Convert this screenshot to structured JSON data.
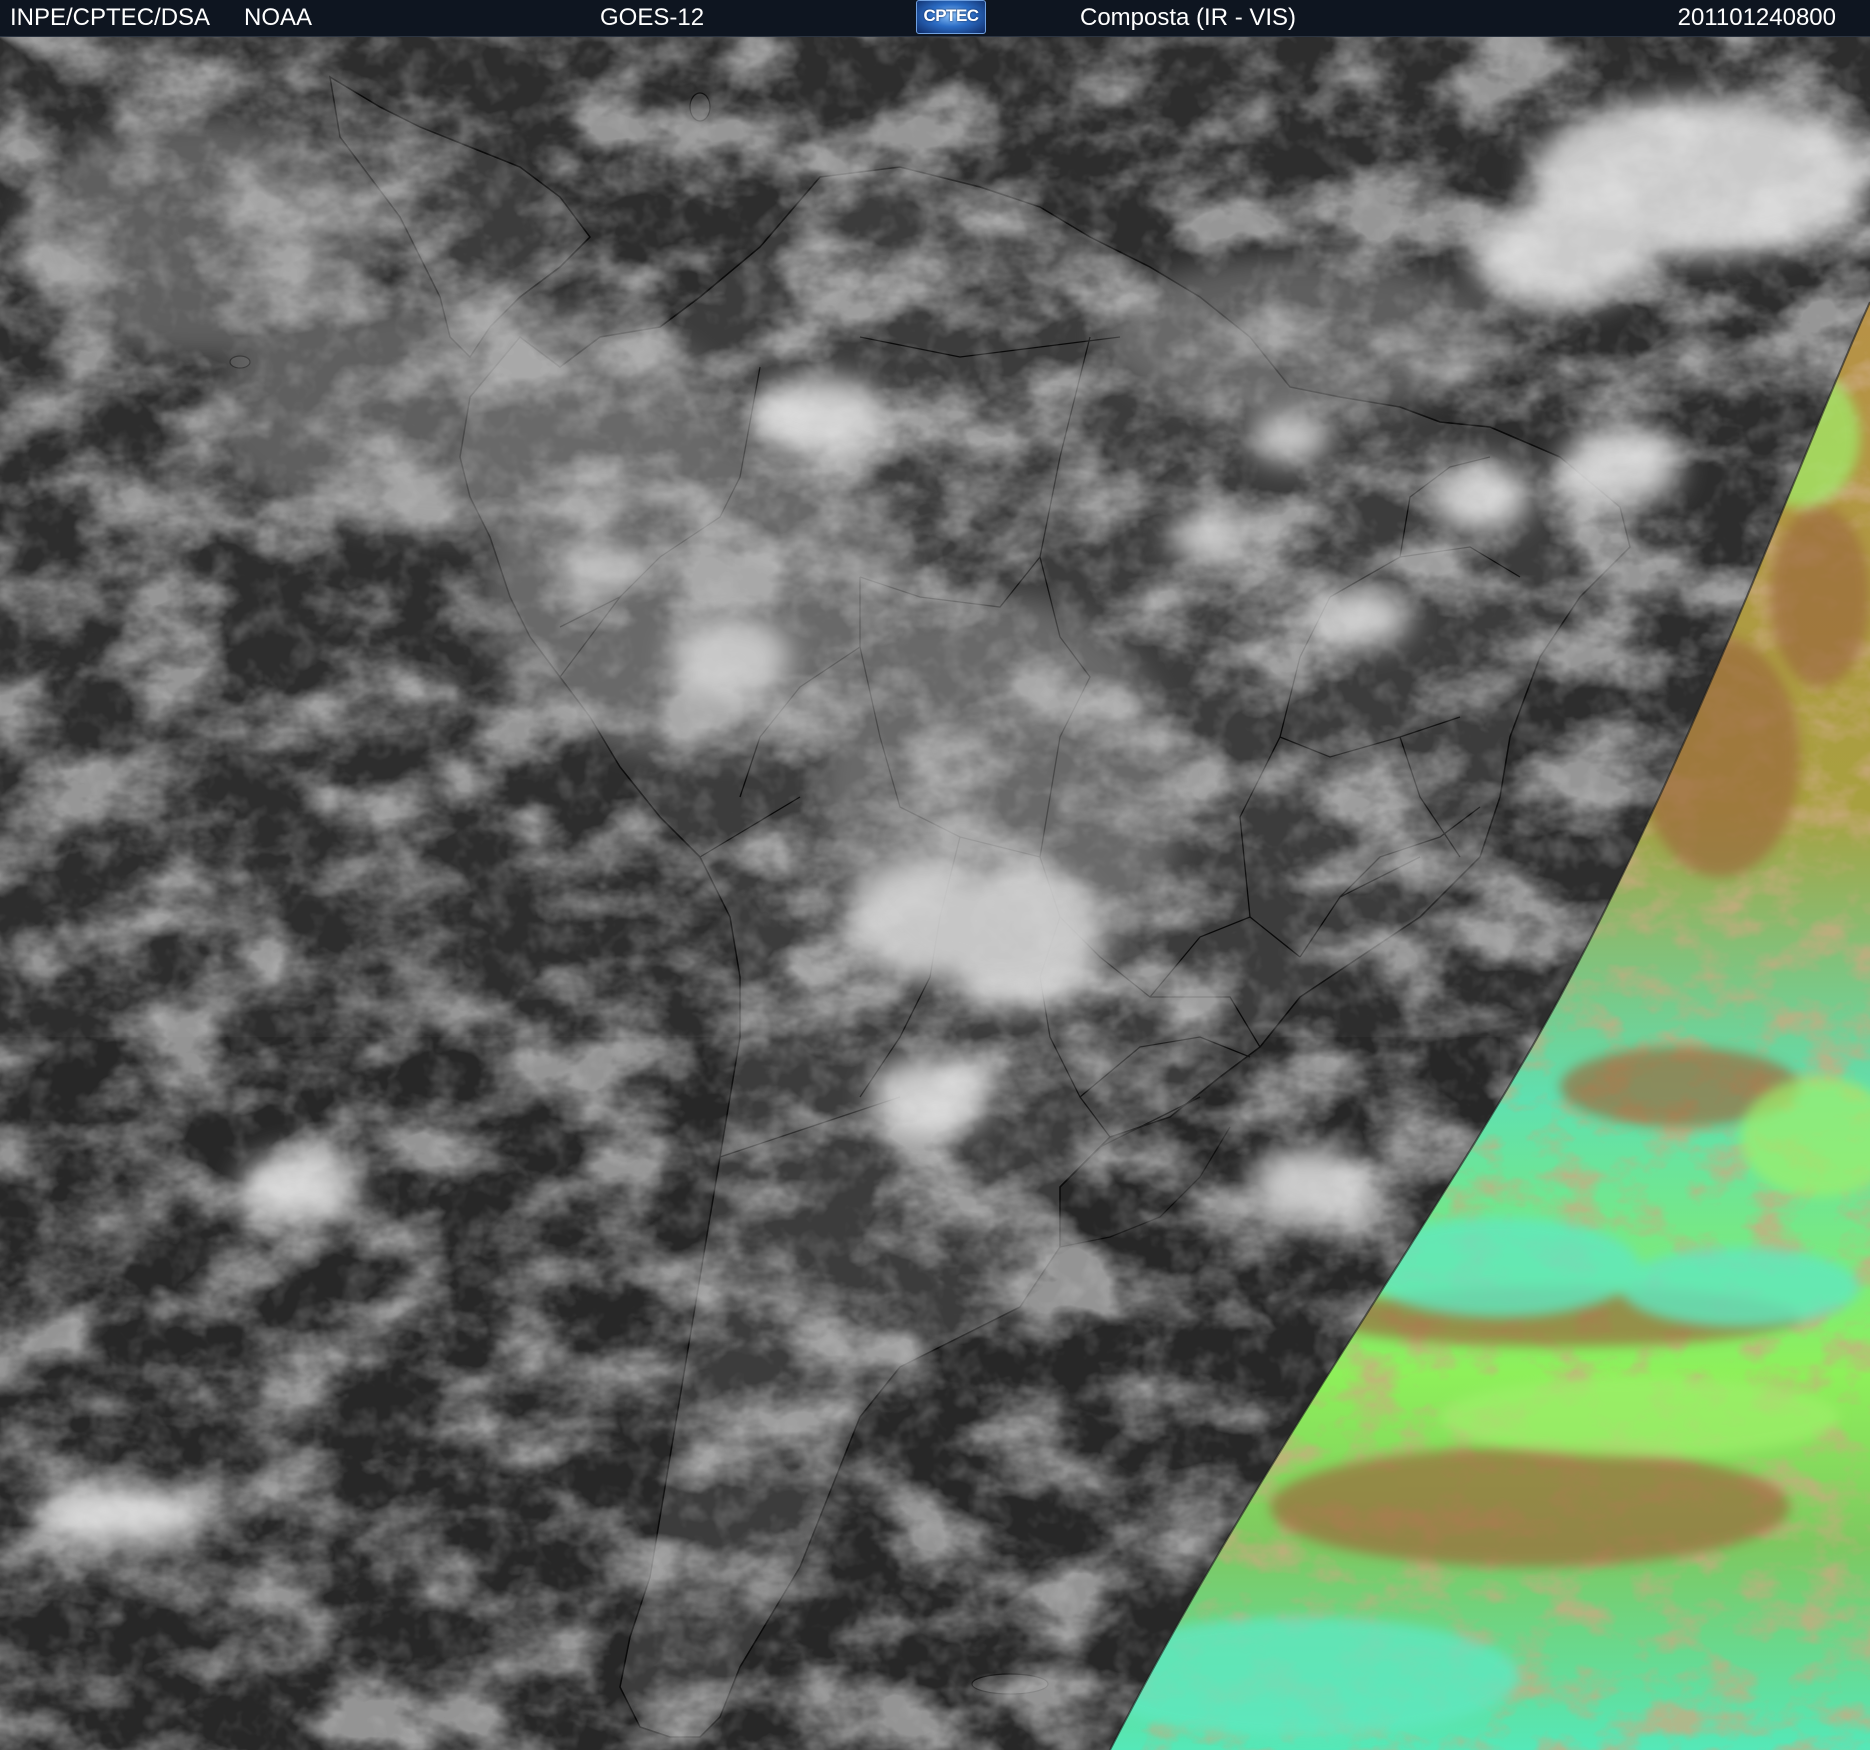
{
  "header": {
    "institution": "INPE/CPTEC/DSA",
    "agency": "NOAA",
    "satellite": "GOES-12",
    "logo_text": "CPTEC",
    "product": "Composta (IR - VIS)",
    "datetime": "201101240800"
  },
  "colors": {
    "header_bg": "#0e1520",
    "ocean_ir": "#2c2c2c",
    "land_ir": "#3a3a3a",
    "cloud": "#d8d8d8",
    "vis_green": "#7ee84a",
    "vis_cyan": "#4fe0b0",
    "vis_brown": "#9a6a3a",
    "border_line": "#0a0a0a"
  }
}
